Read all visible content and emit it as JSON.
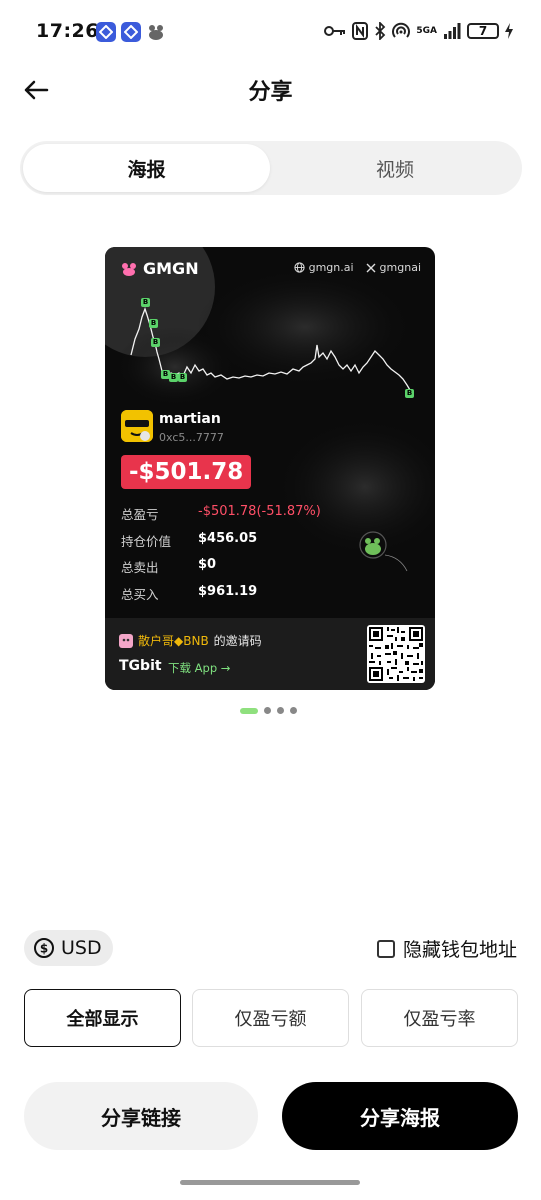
{
  "status_bar": {
    "time": "17:26",
    "network": "5GA",
    "battery": "7"
  },
  "header": {
    "title": "分享"
  },
  "tabs": [
    {
      "label": "海报",
      "active": true
    },
    {
      "label": "视频",
      "active": false
    }
  ],
  "poster": {
    "brand": "GMGN",
    "site": "gmgn.ai",
    "x_handle": "gmgnai",
    "chart_marker": "B",
    "username": "martian",
    "address": "0xc5...7777",
    "pnl_badge": "-$501.78",
    "stats": [
      {
        "label": "总盈亏",
        "value": "-$501.78(-51.87%)"
      },
      {
        "label": "持仓价值",
        "value": "$456.05"
      },
      {
        "label": "总卖出",
        "value": "$0"
      },
      {
        "label": "总买入",
        "value": "$961.19"
      }
    ],
    "invite": {
      "name": "散户哥◆BNB",
      "suffix": "的邀请码"
    },
    "app_name": "TGbit",
    "download_label": "下载 App →"
  },
  "pager": {
    "count": 4,
    "active": 0
  },
  "currency": {
    "label": "USD"
  },
  "hide_wallet": {
    "label": "隐藏钱包地址",
    "checked": false
  },
  "display_options": [
    {
      "label": "全部显示",
      "selected": true
    },
    {
      "label": "仅盈亏额",
      "selected": false
    },
    {
      "label": "仅盈亏率",
      "selected": false
    }
  ],
  "actions": {
    "share_link": "分享链接",
    "share_poster": "分享海报"
  },
  "colors": {
    "loss_red": "#e8344c",
    "accent_green": "#8fe07e",
    "primary_button": "#000000"
  }
}
